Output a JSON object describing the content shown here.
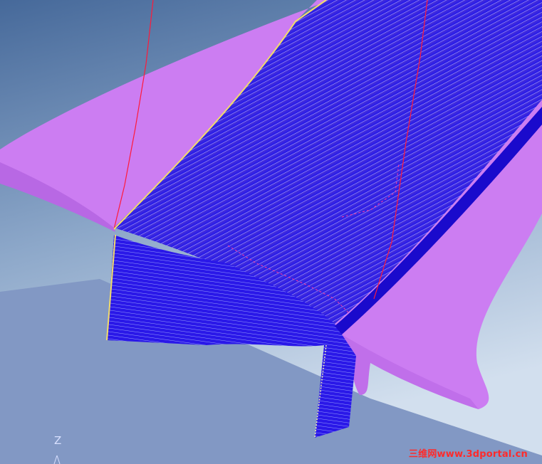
{
  "viewport": {
    "axis_label": "Z",
    "watermark": "三维网www.3dportal.cn"
  },
  "colors": {
    "background_top": "#4a6e9e",
    "background_bottom": "#c6d6e8",
    "floor_plane": "#8298c4",
    "surface": "#cc7df2",
    "toolpath": "#3a1ee6",
    "toolpath_dark": "#1a0acc",
    "guide_line": "#ff1a3a",
    "edge_highlight": "#f2dc6a"
  },
  "scene": {
    "icons": [
      "gizmo-axis-icon"
    ]
  }
}
